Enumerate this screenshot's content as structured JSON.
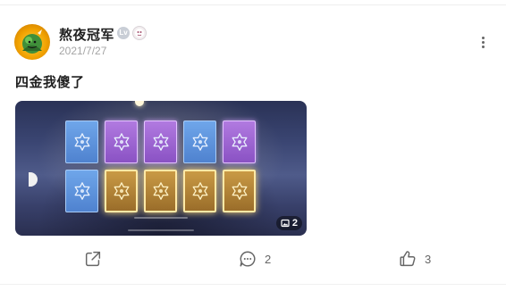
{
  "post": {
    "author": {
      "name": "熬夜冠军",
      "avatar_icon": "avatar-character-icon",
      "level_badge_icon": "level-badge-icon",
      "role_badge_icon": "role-badge-icon"
    },
    "date": "2021/7/27",
    "title": "四金我傻了",
    "media": {
      "image_count": "2",
      "cards": [
        {
          "rarity": "blue"
        },
        {
          "rarity": "purple"
        },
        {
          "rarity": "purple"
        },
        {
          "rarity": "blue"
        },
        {
          "rarity": "purple"
        },
        {
          "rarity": "blue"
        },
        {
          "rarity": "gold"
        },
        {
          "rarity": "gold"
        },
        {
          "rarity": "gold"
        },
        {
          "rarity": "gold"
        }
      ]
    },
    "actions": {
      "share_icon": "share-icon",
      "comment_count": "2",
      "like_count": "3"
    }
  },
  "colors": {
    "blue_card": "#5b8fd9",
    "purple_card": "#9b63d1",
    "gold_card": "#c99a45"
  }
}
